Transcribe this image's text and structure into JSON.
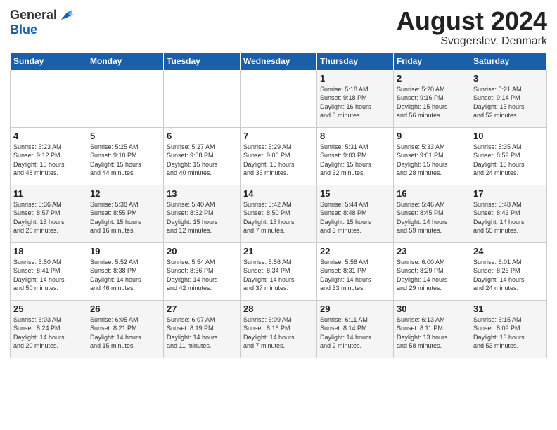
{
  "header": {
    "logo_general": "General",
    "logo_blue": "Blue",
    "month_year": "August 2024",
    "location": "Svogerslev, Denmark"
  },
  "weekdays": [
    "Sunday",
    "Monday",
    "Tuesday",
    "Wednesday",
    "Thursday",
    "Friday",
    "Saturday"
  ],
  "weeks": [
    [
      {
        "day": "",
        "info": ""
      },
      {
        "day": "",
        "info": ""
      },
      {
        "day": "",
        "info": ""
      },
      {
        "day": "",
        "info": ""
      },
      {
        "day": "1",
        "info": "Sunrise: 5:18 AM\nSunset: 9:18 PM\nDaylight: 16 hours\nand 0 minutes."
      },
      {
        "day": "2",
        "info": "Sunrise: 5:20 AM\nSunset: 9:16 PM\nDaylight: 15 hours\nand 56 minutes."
      },
      {
        "day": "3",
        "info": "Sunrise: 5:21 AM\nSunset: 9:14 PM\nDaylight: 15 hours\nand 52 minutes."
      }
    ],
    [
      {
        "day": "4",
        "info": "Sunrise: 5:23 AM\nSunset: 9:12 PM\nDaylight: 15 hours\nand 48 minutes."
      },
      {
        "day": "5",
        "info": "Sunrise: 5:25 AM\nSunset: 9:10 PM\nDaylight: 15 hours\nand 44 minutes."
      },
      {
        "day": "6",
        "info": "Sunrise: 5:27 AM\nSunset: 9:08 PM\nDaylight: 15 hours\nand 40 minutes."
      },
      {
        "day": "7",
        "info": "Sunrise: 5:29 AM\nSunset: 9:06 PM\nDaylight: 15 hours\nand 36 minutes."
      },
      {
        "day": "8",
        "info": "Sunrise: 5:31 AM\nSunset: 9:03 PM\nDaylight: 15 hours\nand 32 minutes."
      },
      {
        "day": "9",
        "info": "Sunrise: 5:33 AM\nSunset: 9:01 PM\nDaylight: 15 hours\nand 28 minutes."
      },
      {
        "day": "10",
        "info": "Sunrise: 5:35 AM\nSunset: 8:59 PM\nDaylight: 15 hours\nand 24 minutes."
      }
    ],
    [
      {
        "day": "11",
        "info": "Sunrise: 5:36 AM\nSunset: 8:57 PM\nDaylight: 15 hours\nand 20 minutes."
      },
      {
        "day": "12",
        "info": "Sunrise: 5:38 AM\nSunset: 8:55 PM\nDaylight: 15 hours\nand 16 minutes."
      },
      {
        "day": "13",
        "info": "Sunrise: 5:40 AM\nSunset: 8:52 PM\nDaylight: 15 hours\nand 12 minutes."
      },
      {
        "day": "14",
        "info": "Sunrise: 5:42 AM\nSunset: 8:50 PM\nDaylight: 15 hours\nand 7 minutes."
      },
      {
        "day": "15",
        "info": "Sunrise: 5:44 AM\nSunset: 8:48 PM\nDaylight: 15 hours\nand 3 minutes."
      },
      {
        "day": "16",
        "info": "Sunrise: 5:46 AM\nSunset: 8:45 PM\nDaylight: 14 hours\nand 59 minutes."
      },
      {
        "day": "17",
        "info": "Sunrise: 5:48 AM\nSunset: 8:43 PM\nDaylight: 14 hours\nand 55 minutes."
      }
    ],
    [
      {
        "day": "18",
        "info": "Sunrise: 5:50 AM\nSunset: 8:41 PM\nDaylight: 14 hours\nand 50 minutes."
      },
      {
        "day": "19",
        "info": "Sunrise: 5:52 AM\nSunset: 8:38 PM\nDaylight: 14 hours\nand 46 minutes."
      },
      {
        "day": "20",
        "info": "Sunrise: 5:54 AM\nSunset: 8:36 PM\nDaylight: 14 hours\nand 42 minutes."
      },
      {
        "day": "21",
        "info": "Sunrise: 5:56 AM\nSunset: 8:34 PM\nDaylight: 14 hours\nand 37 minutes."
      },
      {
        "day": "22",
        "info": "Sunrise: 5:58 AM\nSunset: 8:31 PM\nDaylight: 14 hours\nand 33 minutes."
      },
      {
        "day": "23",
        "info": "Sunrise: 6:00 AM\nSunset: 8:29 PM\nDaylight: 14 hours\nand 29 minutes."
      },
      {
        "day": "24",
        "info": "Sunrise: 6:01 AM\nSunset: 8:26 PM\nDaylight: 14 hours\nand 24 minutes."
      }
    ],
    [
      {
        "day": "25",
        "info": "Sunrise: 6:03 AM\nSunset: 8:24 PM\nDaylight: 14 hours\nand 20 minutes."
      },
      {
        "day": "26",
        "info": "Sunrise: 6:05 AM\nSunset: 8:21 PM\nDaylight: 14 hours\nand 15 minutes."
      },
      {
        "day": "27",
        "info": "Sunrise: 6:07 AM\nSunset: 8:19 PM\nDaylight: 14 hours\nand 11 minutes."
      },
      {
        "day": "28",
        "info": "Sunrise: 6:09 AM\nSunset: 8:16 PM\nDaylight: 14 hours\nand 7 minutes."
      },
      {
        "day": "29",
        "info": "Sunrise: 6:11 AM\nSunset: 8:14 PM\nDaylight: 14 hours\nand 2 minutes."
      },
      {
        "day": "30",
        "info": "Sunrise: 6:13 AM\nSunset: 8:11 PM\nDaylight: 13 hours\nand 58 minutes."
      },
      {
        "day": "31",
        "info": "Sunrise: 6:15 AM\nSunset: 8:09 PM\nDaylight: 13 hours\nand 53 minutes."
      }
    ]
  ]
}
